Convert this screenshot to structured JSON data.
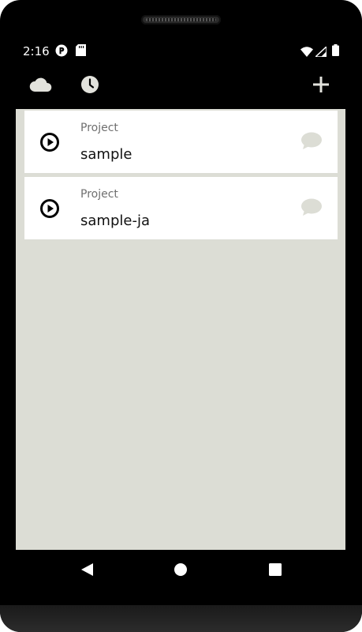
{
  "status_bar": {
    "time": "2:16",
    "icons": [
      "app-notification-icon",
      "sd-card-icon",
      "wifi-icon",
      "signal-icon",
      "battery-icon"
    ]
  },
  "app_bar": {
    "actions": [
      "cloud-icon",
      "history-clock-icon",
      "add-icon"
    ]
  },
  "projects": [
    {
      "type_label": "Project",
      "name": "sample"
    },
    {
      "type_label": "Project",
      "name": "sample-ja"
    }
  ],
  "nav_bar": {
    "buttons": [
      "back-icon",
      "home-icon",
      "recents-icon"
    ]
  },
  "colors": {
    "background": "#dcddd5",
    "card": "#ffffff",
    "bar": "#000000",
    "appbar_icon": "#e2e2dc",
    "comment_icon": "#dcddd5",
    "secondary_text": "#6f6f6f"
  }
}
